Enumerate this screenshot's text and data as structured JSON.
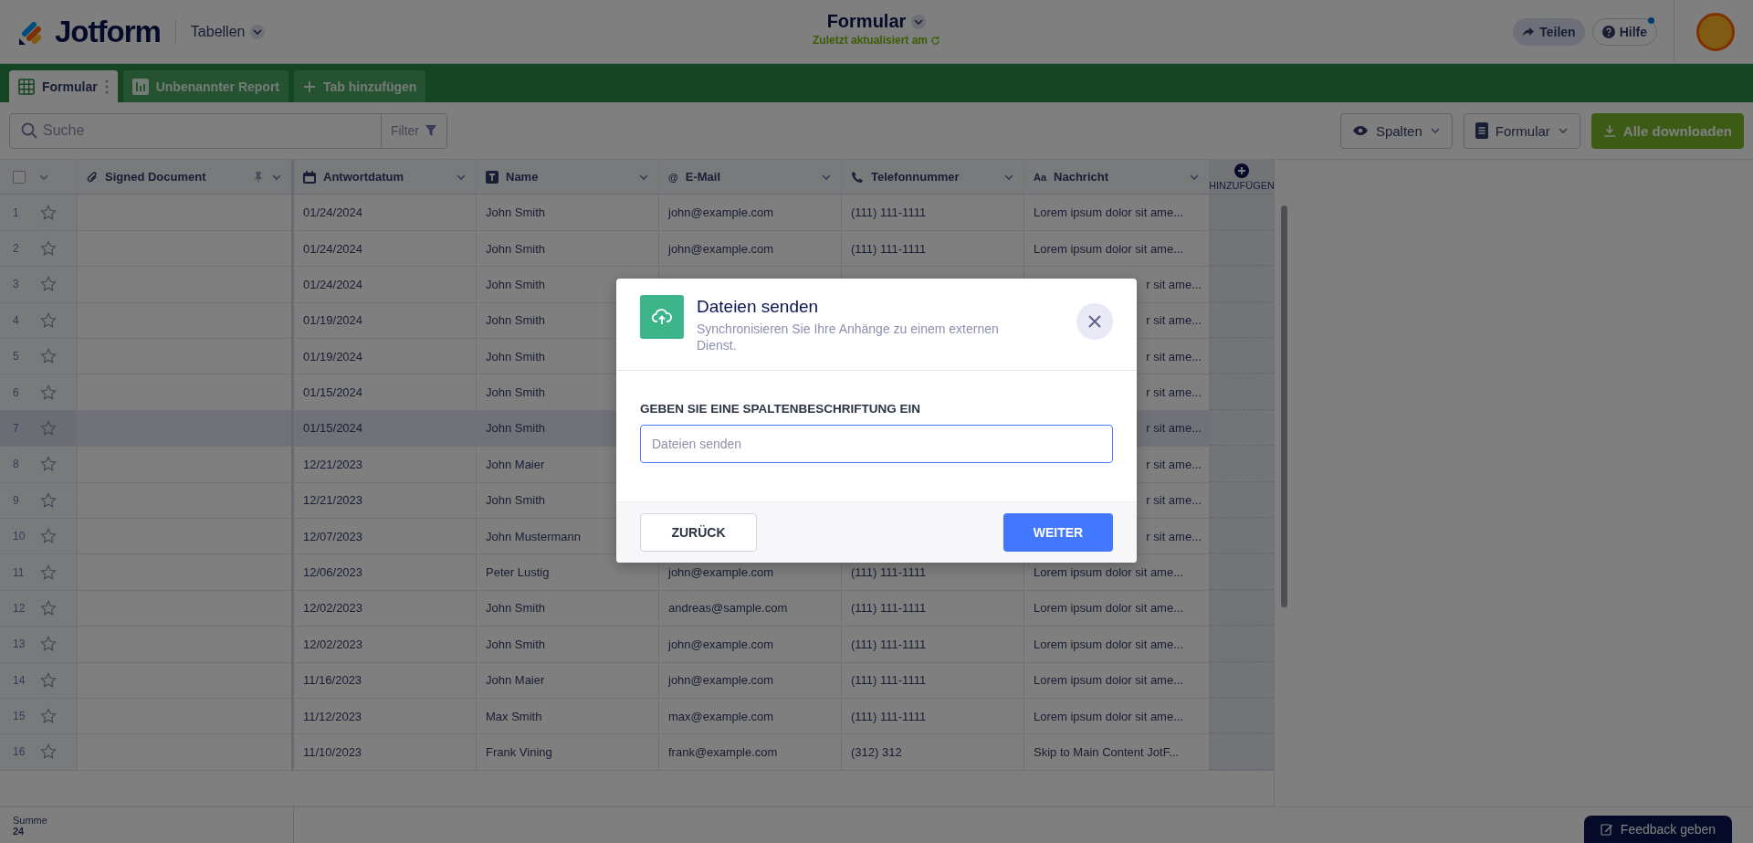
{
  "header": {
    "logo": "Jotform",
    "menu": "Tabellen",
    "title": "Formular",
    "subtitle": "Zuletzt aktualisiert am",
    "share": "Teilen",
    "help": "Hilfe",
    "help_notification": true
  },
  "tabs": [
    {
      "label": "Formular",
      "kind": "table",
      "selected": true
    },
    {
      "label": "Unbenannter Report",
      "kind": "report",
      "selected": false
    },
    {
      "label": "Tab hinzufügen",
      "kind": "add",
      "selected": false
    }
  ],
  "toolbar": {
    "search_placeholder": "Suche",
    "filter": "Filter",
    "columns": "Spalten",
    "form": "Formular",
    "download": "Alle downloaden"
  },
  "table": {
    "columns": [
      {
        "label": "Signed Document",
        "kind": "file",
        "pinned": true
      },
      {
        "label": "Antwortdatum",
        "kind": "date",
        "pinned": false
      },
      {
        "label": "Name",
        "kind": "name",
        "pinned": false
      },
      {
        "label": "E-Mail",
        "kind": "email",
        "glyph": "@",
        "pinned": false
      },
      {
        "label": "Telefonnummer",
        "kind": "phone",
        "pinned": false
      },
      {
        "label": "Nachricht",
        "kind": "message",
        "glyph": "Aa",
        "pinned": false
      }
    ],
    "add_column": "HINZUFÜGEN",
    "select_all": {
      "checked": false
    },
    "rows": [
      {
        "number": "1",
        "starred": false,
        "hovered": false,
        "date": "01/24/2024",
        "name": "John Smith",
        "email": "john@example.com",
        "phone": "(111) 111-1111",
        "message": "Lorem ipsum dolor sit ame..."
      },
      {
        "number": "2",
        "starred": false,
        "hovered": false,
        "date": "01/24/2024",
        "name": "John Smith",
        "email": "john@example.com",
        "phone": "(111) 111-1111",
        "message": "Lorem ipsum dolor sit ame..."
      },
      {
        "number": "3",
        "starred": false,
        "hovered": false,
        "date": "01/24/2024",
        "name": "John Smith",
        "message": "r sit ame..."
      },
      {
        "number": "4",
        "starred": false,
        "hovered": false,
        "date": "01/19/2024",
        "name": "John Smith",
        "message": "r sit ame..."
      },
      {
        "number": "5",
        "starred": false,
        "hovered": false,
        "date": "01/19/2024",
        "name": "John Smith",
        "message": "r sit ame..."
      },
      {
        "number": "6",
        "starred": false,
        "hovered": false,
        "date": "01/15/2024",
        "name": "John Smith",
        "message": "r sit ame..."
      },
      {
        "number": "7",
        "starred": false,
        "hovered": true,
        "date": "01/15/2024",
        "name": "John Smith",
        "message": "r sit ame..."
      },
      {
        "number": "8",
        "starred": false,
        "hovered": false,
        "date": "12/21/2023",
        "name": "John Maier",
        "message": "r sit ame..."
      },
      {
        "number": "9",
        "starred": false,
        "hovered": false,
        "date": "12/21/2023",
        "name": "John Smith",
        "message": "r sit ame..."
      },
      {
        "number": "10",
        "starred": false,
        "hovered": false,
        "date": "12/07/2023",
        "name": "John Mustermann",
        "message": "r sit ame..."
      },
      {
        "number": "11",
        "starred": false,
        "hovered": false,
        "date": "12/06/2023",
        "name": "Peter Lustig",
        "email": "john@example.com",
        "phone": "(111) 111-1111",
        "message": "Lorem ipsum dolor sit ame..."
      },
      {
        "number": "12",
        "starred": false,
        "hovered": false,
        "date": "12/02/2023",
        "name": "John Smith",
        "email": "andreas@sample.com",
        "phone": "(111) 111-1111",
        "message": "Lorem ipsum dolor sit ame..."
      },
      {
        "number": "13",
        "starred": false,
        "hovered": false,
        "date": "12/02/2023",
        "name": "John Smith",
        "email": "john@example.com",
        "phone": "(111) 111-1111",
        "message": "Lorem ipsum dolor sit ame..."
      },
      {
        "number": "14",
        "starred": false,
        "hovered": false,
        "date": "11/16/2023",
        "name": "John Maier",
        "email": "john@example.com",
        "phone": "(111) 111-1111",
        "message": "Lorem ipsum dolor sit ame..."
      },
      {
        "number": "15",
        "starred": false,
        "hovered": false,
        "date": "11/12/2023",
        "name": "Max Smith",
        "email": "max@example.com",
        "phone": "(111) 111-1111",
        "message": "Lorem ipsum dolor sit ame..."
      },
      {
        "number": "16",
        "starred": false,
        "hovered": false,
        "date": "11/10/2023",
        "name": "Frank Vining",
        "email": "frank@example.com",
        "phone": "(312) 312",
        "message": "Skip to Main Content JotF..."
      }
    ]
  },
  "footer": {
    "sum_label": "Summe",
    "sum": "24",
    "feedback": "Feedback geben"
  },
  "modal": {
    "title": "Dateien senden",
    "subtitle": "Synchronisieren Sie Ihre Anhänge zu einem externen Dienst.",
    "field_label": "GEBEN SIE EINE SPALTENBESCHRIFTUNG EIN",
    "placeholder": "Dateien senden",
    "back": "ZURÜCK",
    "next": "WEITER"
  }
}
